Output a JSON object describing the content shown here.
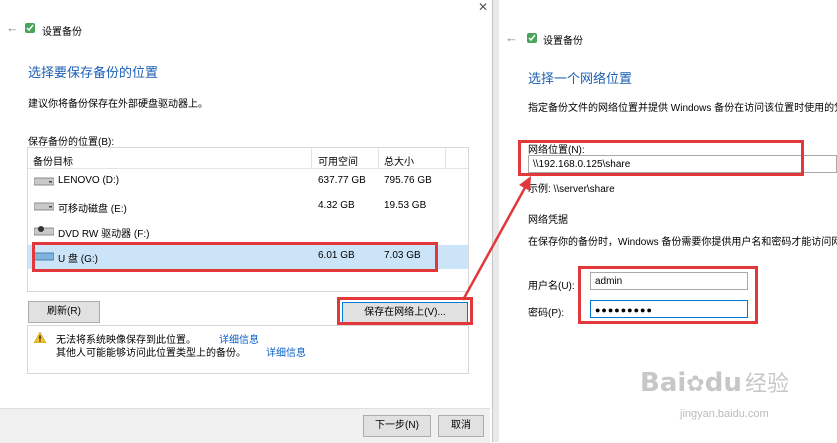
{
  "left_window": {
    "back_arrow": "←",
    "title": "设置备份",
    "heading": "选择要保存备份的位置",
    "description": "建议你将备份保存在外部硬盘驱动器上。",
    "list_label": "保存备份的位置(B):",
    "columns": [
      "备份目标",
      "可用空间",
      "总大小"
    ],
    "rows": [
      {
        "name": "LENOVO (D:)",
        "free": "637.77 GB",
        "total": "795.76 GB",
        "selected": false
      },
      {
        "name": "可移动磁盘 (E:)",
        "free": "4.32 GB",
        "total": "19.53 GB",
        "selected": false
      },
      {
        "name": "DVD RW 驱动器 (F:)",
        "free": "",
        "total": "",
        "selected": false
      },
      {
        "name": "U 盘 (G:)",
        "free": "6.01 GB",
        "total": "7.03 GB",
        "selected": true
      }
    ],
    "refresh_button": "刷新(R)",
    "save_network_button": "保存在网络上(V)...",
    "warning1": "无法将系统映像保存到此位置。",
    "warning1_link": "详细信息",
    "warning2": "其他人可能能够访问此位置类型上的备份。",
    "warning2_link": "详细信息",
    "next_button": "下一步(N)",
    "cancel_button": "取消"
  },
  "right_window": {
    "back_arrow": "←",
    "title": "设置备份",
    "heading": "选择一个网络位置",
    "description": "指定备份文件的网络位置并提供 Windows 备份在访问该位置时使用的凭据",
    "network_location_label": "网络位置(N):",
    "network_location_value": "\\\\192.168.0.125\\share",
    "example": "示例: \\\\server\\share",
    "credentials_heading": "网络凭据",
    "credentials_desc": "在保存你的备份时，Windows 备份需要你提供用户名和密码才能访问网络",
    "username_label": "用户名(U):",
    "username_value": "admin",
    "password_label": "密码(P):",
    "password_value": "●●●●●●●●●"
  },
  "watermark": {
    "brand": "Bai",
    "brand2": "du",
    "suffix": "经验",
    "url": "jingyan.baidu.com"
  },
  "colors": {
    "highlight_red": "#e3383b",
    "link_blue": "#0a5fc6",
    "selected_row": "#cce4f7"
  }
}
